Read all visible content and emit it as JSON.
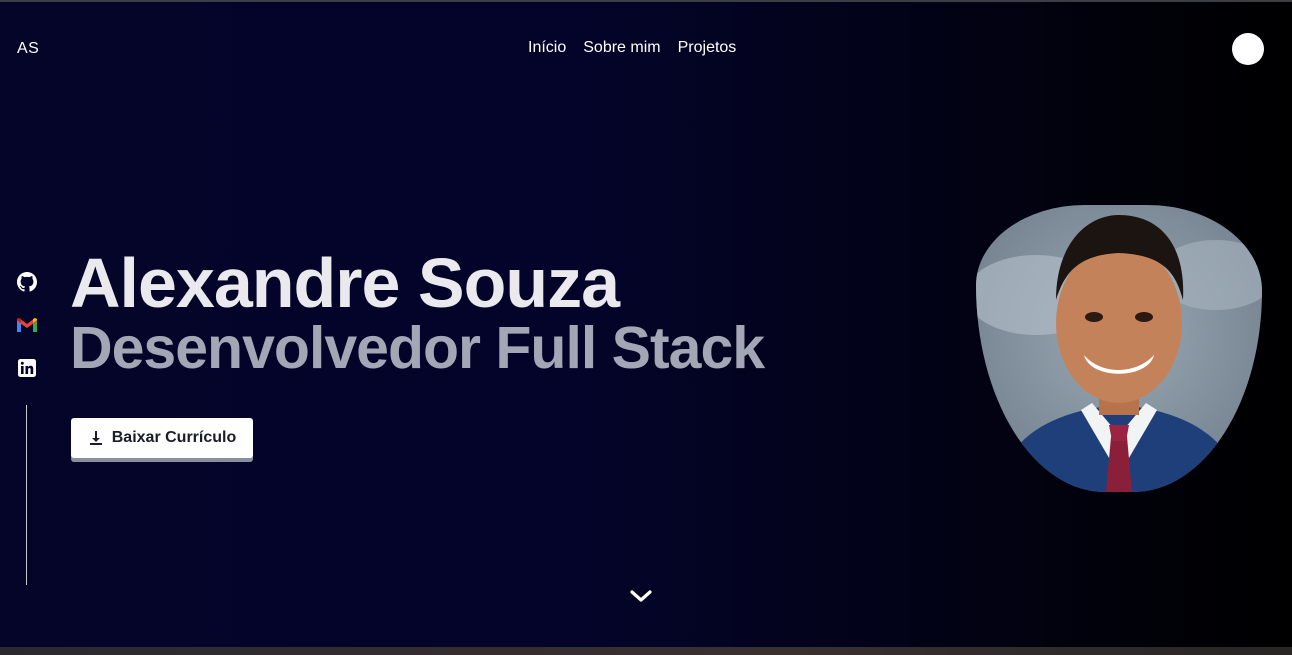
{
  "header": {
    "logo": "AS",
    "nav": [
      "Início",
      "Sobre mim",
      "Projetos"
    ],
    "theme_toggle_icon": "theme-toggle-icon"
  },
  "social": {
    "items": [
      {
        "name": "github-icon"
      },
      {
        "name": "gmail-icon"
      },
      {
        "name": "linkedin-icon"
      }
    ]
  },
  "hero": {
    "name": "Alexandre Souza",
    "role": "Desenvolvedor Full Stack",
    "cv_button_label": "Baixar Currículo",
    "cv_button_icon": "download-icon",
    "scroll_icon": "chevron-down-icon"
  },
  "colors": {
    "background_start": "#05052a",
    "background_end": "#000000",
    "name_color": "#e9e9ee",
    "role_color": "#a3a6b4",
    "button_bg": "#ffffff"
  }
}
